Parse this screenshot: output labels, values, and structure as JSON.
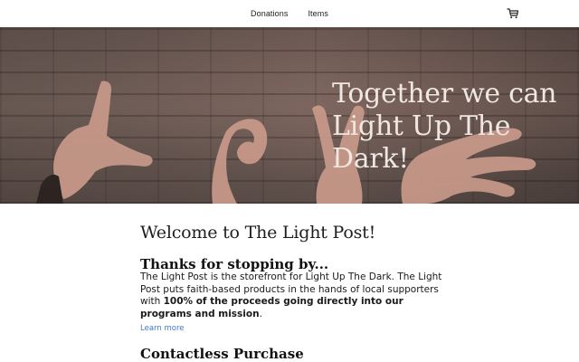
{
  "nav": {
    "links": [
      "Donations",
      "Items"
    ],
    "cart_icon": "shopping-cart-icon"
  },
  "hero": {
    "title": "Together we can Light Up The Dark!"
  },
  "main": {
    "title": "Welcome to The Light Post!",
    "intro_heading": "Thanks for stopping by...",
    "intro_text_part1": "The Light Post is the storefront for Light Up The Dark. The Light Post puts faith-based products in the hands of local supporters with ",
    "intro_text_bold": "100% of the proceeds going directly into our programs and mission",
    "intro_text_part2": ".",
    "learn_more": "Learn more",
    "second_heading": "Contactless Purchase"
  },
  "colors": {
    "link": "#3d7bd1",
    "hero_text": "#efe7e2"
  }
}
